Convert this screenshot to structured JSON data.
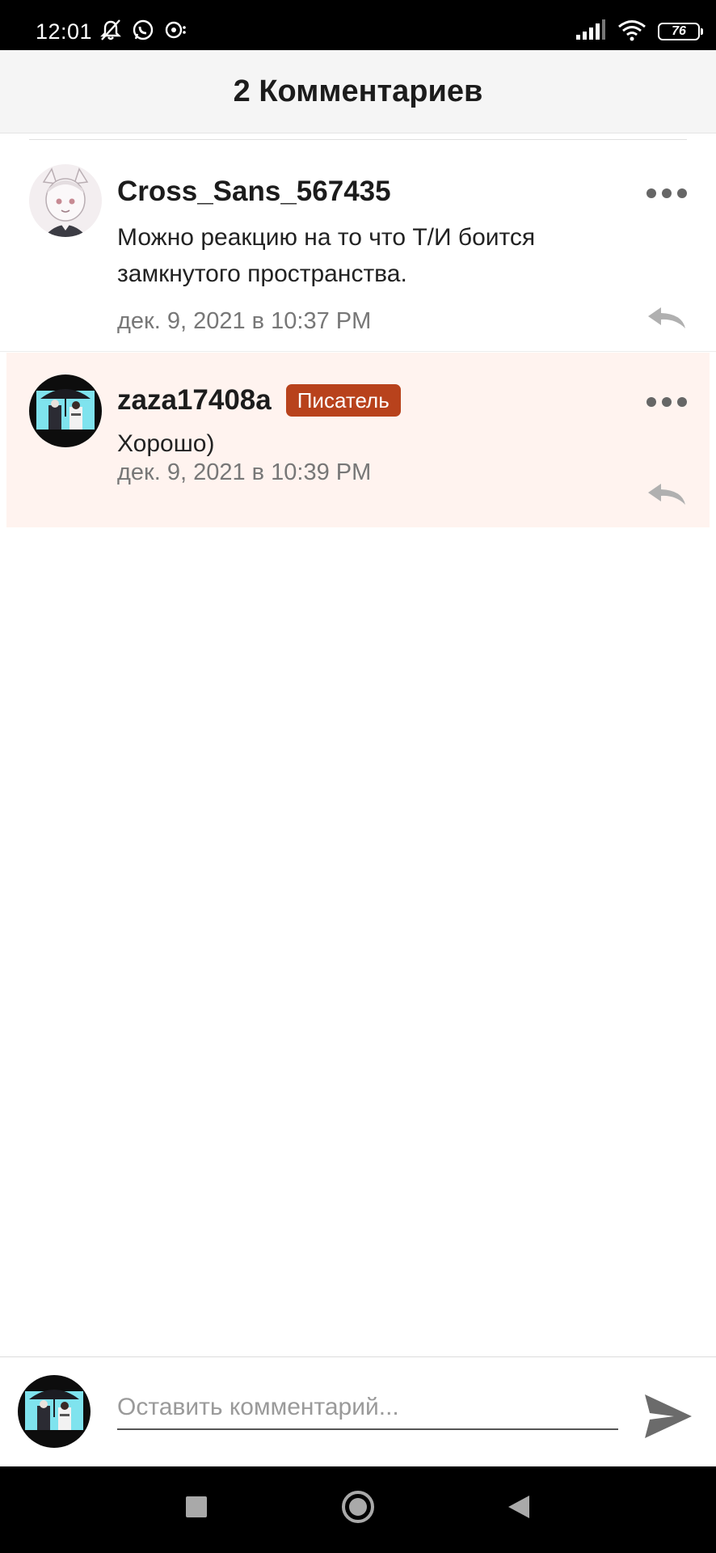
{
  "status_bar": {
    "time": "12:01",
    "battery": "76",
    "icons": [
      "notifications-off-icon",
      "whatsapp-icon",
      "media-icon",
      "signal-icon",
      "wifi-icon",
      "battery-icon"
    ]
  },
  "header": {
    "title": "2 Комментариев"
  },
  "comments": [
    {
      "author": "Cross_Sans_567435",
      "badge": "",
      "text": "Можно реакцию на то что Т/И боится замкнутого пространства.",
      "time": "дек. 9, 2021 в 10:37 PM",
      "highlighted": false
    },
    {
      "author": "zaza17408a",
      "badge": "Писатель",
      "text": "Хорошо)",
      "time": "дек. 9, 2021 в 10:39 PM",
      "highlighted": true
    }
  ],
  "composer": {
    "placeholder": "Оставить комментарий...",
    "value": ""
  },
  "colors": {
    "badge_background": "#b8421c",
    "highlight_background": "#fff3ef",
    "header_background": "#f5f5f5",
    "icon_gray": "#666666"
  }
}
